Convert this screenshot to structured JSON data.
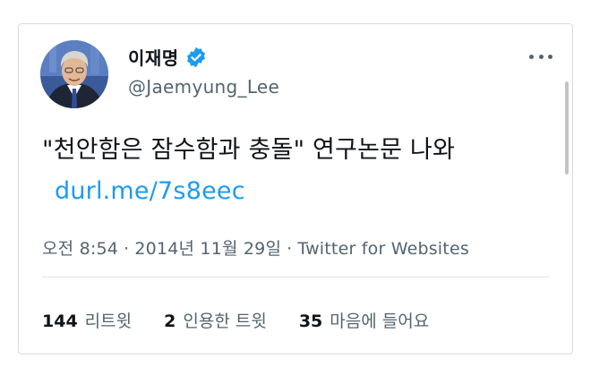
{
  "author": {
    "display_name": "이재명",
    "handle": "@Jaemyung_Lee",
    "verified": true
  },
  "tweet": {
    "text": "\"천안함은 잠수함과 충돌\" 연구논문 나와",
    "link": "durl.me/7s8eec"
  },
  "meta": {
    "time": "오전 8:54",
    "date": "2014년 11월 29일",
    "source": "Twitter for Websites",
    "separator": "·"
  },
  "stats": {
    "retweets": {
      "count": "144",
      "label": "리트윗"
    },
    "quotes": {
      "count": "2",
      "label": "인용한 트윗"
    },
    "likes": {
      "count": "35",
      "label": "마음에 들어요"
    }
  },
  "colors": {
    "link": "#1d9bf0",
    "verified": "#1d9bf0",
    "text": "#0f1419",
    "muted": "#536471"
  },
  "icons": {
    "verified": "verified-badge-icon",
    "more": "more-options-icon"
  }
}
